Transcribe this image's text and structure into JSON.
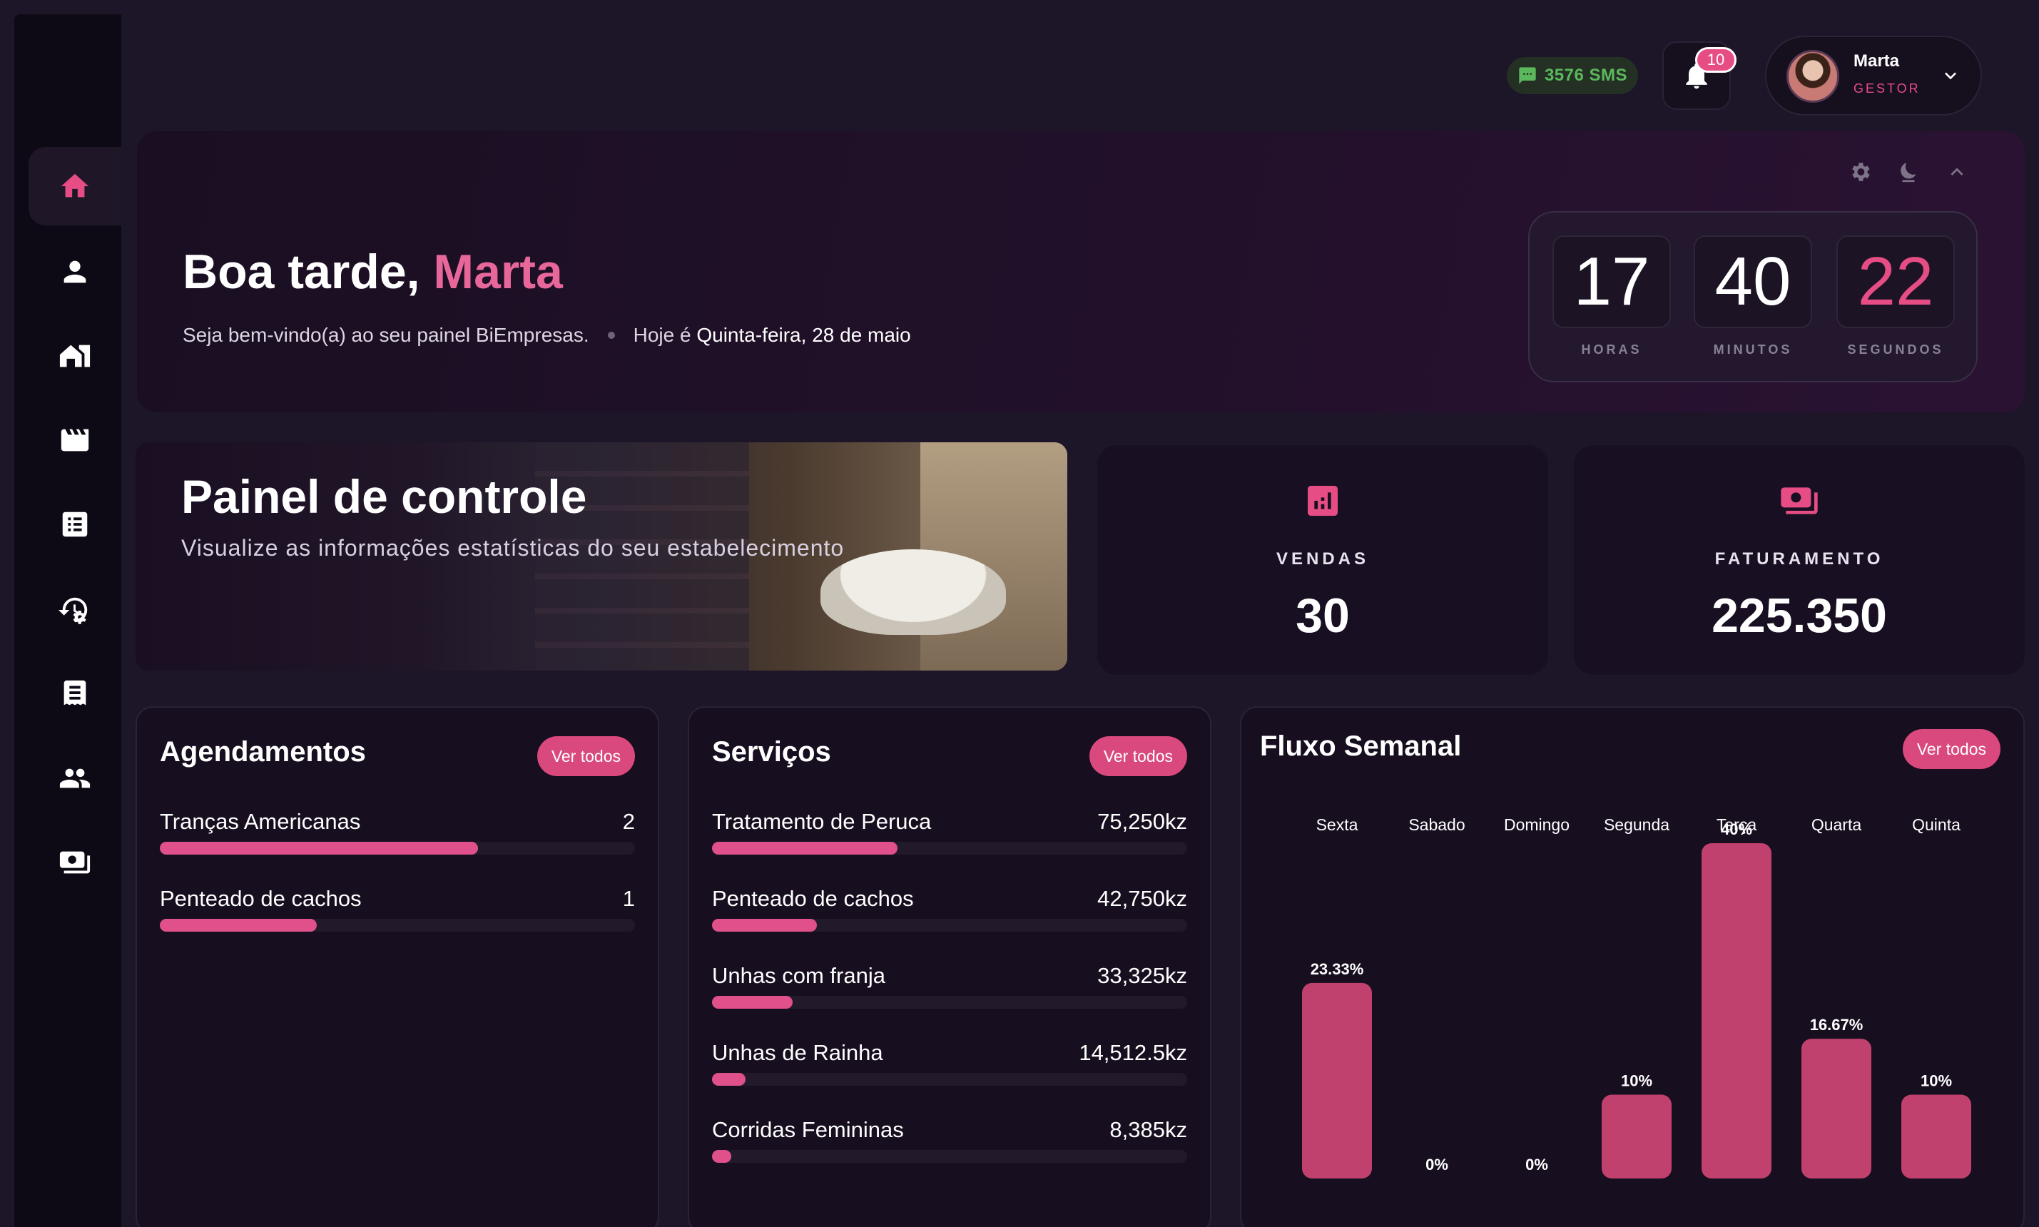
{
  "topbar": {
    "sms_label": "3576 SMS",
    "notif_count": "10",
    "user_name": "Marta",
    "user_role": "GESTOR"
  },
  "sidebar": {
    "items": [
      {
        "icon": "home-icon",
        "active": true
      },
      {
        "icon": "person-icon",
        "active": false
      },
      {
        "icon": "store-icon",
        "active": false
      },
      {
        "icon": "clapperboard-icon",
        "active": false
      },
      {
        "icon": "list-icon",
        "active": false
      },
      {
        "icon": "history-settings-icon",
        "active": false
      },
      {
        "icon": "receipt-icon",
        "active": false
      },
      {
        "icon": "group-icon",
        "active": false
      },
      {
        "icon": "cash-icon",
        "active": false
      }
    ]
  },
  "greeting": {
    "prefix": "Boa tarde, ",
    "name": "Marta",
    "welcome": "Seja bem-vindo(a) ao seu painel BiEmpresas.",
    "today_prefix": "Hoje é ",
    "today_date": "Quinta-feira, 28 de maio"
  },
  "clock": {
    "hours": "17",
    "minutes": "40",
    "seconds": "22",
    "hours_label": "HORAS",
    "minutes_label": "MINUTOS",
    "seconds_label": "SEGUNDOS"
  },
  "hero": {
    "title": "Painel de controle",
    "subtitle": "Visualize as informações estatísticas do seu estabelecimento"
  },
  "stats": {
    "sales_label": "VENDAS",
    "sales_value": "30",
    "revenue_label": "FATURAMENTO",
    "revenue_value": "225.350"
  },
  "appointments": {
    "title": "Agendamentos",
    "button": "Ver todos",
    "items": [
      {
        "label": "Tranças Americanas",
        "value": "2",
        "fraction": 0.67
      },
      {
        "label": "Penteado de cachos",
        "value": "1",
        "fraction": 0.33
      }
    ]
  },
  "services": {
    "title": "Serviços",
    "button": "Ver todos",
    "items": [
      {
        "label": "Tratamento de Peruca",
        "value": "75,250kz",
        "fraction": 0.39
      },
      {
        "label": "Penteado de cachos",
        "value": "42,750kz",
        "fraction": 0.22
      },
      {
        "label": "Unhas com franja",
        "value": "33,325kz",
        "fraction": 0.17
      },
      {
        "label": "Unhas de Rainha",
        "value": "14,512.5kz",
        "fraction": 0.07
      },
      {
        "label": "Corridas Femininas",
        "value": "8,385kz",
        "fraction": 0.04
      }
    ]
  },
  "weekly": {
    "title": "Fluxo Semanal",
    "button": "Ver todos"
  },
  "chart_data": {
    "type": "bar",
    "title": "Fluxo Semanal",
    "categories": [
      "Sexta",
      "Sabado",
      "Domingo",
      "Segunda",
      "Terça",
      "Quarta",
      "Quinta"
    ],
    "values": [
      23.33,
      0,
      0,
      10,
      40,
      16.67,
      10
    ],
    "labels": [
      "23.33%",
      "0%",
      "0%",
      "10%",
      "40%",
      "16.67%",
      "10%"
    ],
    "ylim": [
      0,
      40
    ],
    "bar_color": "#c0416e",
    "grid": false
  },
  "colors": {
    "accent": "#e64d85",
    "sms_green": "#5cb85c",
    "background": "#1d1528"
  }
}
